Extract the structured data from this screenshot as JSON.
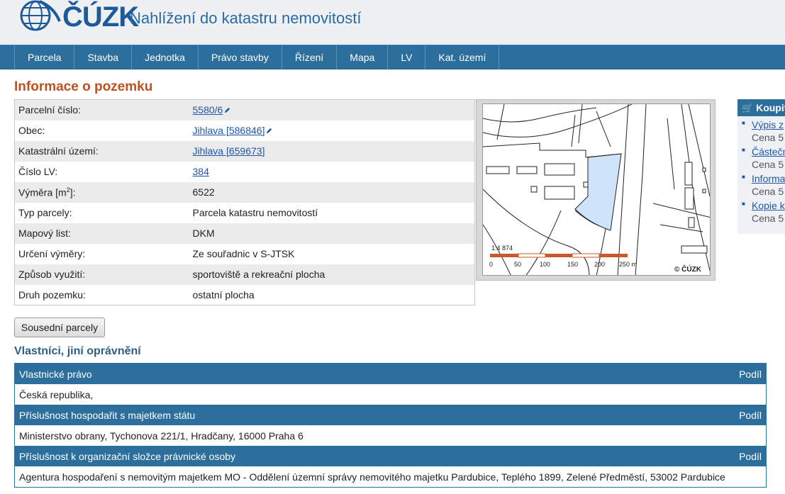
{
  "header": {
    "logo_text": "ČÚZK",
    "title": "Nahlížení do katastru nemovitostí"
  },
  "nav": [
    "Parcela",
    "Stavba",
    "Jednotka",
    "Právo stavby",
    "Řízení",
    "Mapa",
    "LV",
    "Kat. území"
  ],
  "page_title": "Informace o pozemku",
  "info": {
    "parcel_label": "Parcelní číslo:",
    "parcel_value": "5580/6",
    "obec_label": "Obec:",
    "obec_value": "Jihlava [586846]",
    "ku_label": "Katastrální území:",
    "ku_value": "Jihlava [659673]",
    "lv_label": "Číslo LV:",
    "lv_value": "384",
    "vymera_label_pre": "Výměra [m",
    "vymera_label_sup": "2",
    "vymera_label_post": "]:",
    "vymera_value": "6522",
    "typ_label": "Typ parcely:",
    "typ_value": "Parcela katastru nemovitostí",
    "mapovy_label": "Mapový list:",
    "mapovy_value": "DKM",
    "urceni_label": "Určení výměry:",
    "urceni_value": "Ze souřadnic v S-JTSK",
    "zpusob_label": "Způsob využití:",
    "zpusob_value": "sportoviště a rekreační plocha",
    "druh_label": "Druh pozemku:",
    "druh_value": "ostatní plocha"
  },
  "map": {
    "scale": "1:4 874",
    "ticks": [
      "0",
      "50",
      "100",
      "150",
      "200",
      "250 m"
    ],
    "copyright": "© ČÚZK",
    "highlight_color": "#cfe4fa"
  },
  "buy": {
    "title": "Koupit",
    "items": [
      {
        "link": "Výpis z",
        "price": "Cena 5"
      },
      {
        "link": "Částečn",
        "price": "Cena 5"
      },
      {
        "link": "Informa",
        "price": "Cena 5"
      },
      {
        "link": "Kopie k",
        "price": "Cena 5"
      }
    ]
  },
  "neighbors_button": "Sousední parcely",
  "owners": {
    "title": "Vlastníci, jiní oprávnění",
    "sections": [
      {
        "header": "Vlastnické právo",
        "share": "Podíl",
        "row": "Česká republika,"
      },
      {
        "header": "Příslušnost hospodařit s majetkem státu",
        "share": "Podíl",
        "row": "Ministerstvo obrany, Tychonova 221/1, Hradčany, 16000 Praha 6"
      },
      {
        "header": "Příslušnost k organizační složce právnické osoby",
        "share": "Podíl",
        "row": "Agentura hospodaření s nemovitým majetkem MO - Oddělení územní správy nemovitého majetku Pardubice, Teplého 1899, Zelené Předměstí, 53002 Pardubice"
      }
    ]
  }
}
